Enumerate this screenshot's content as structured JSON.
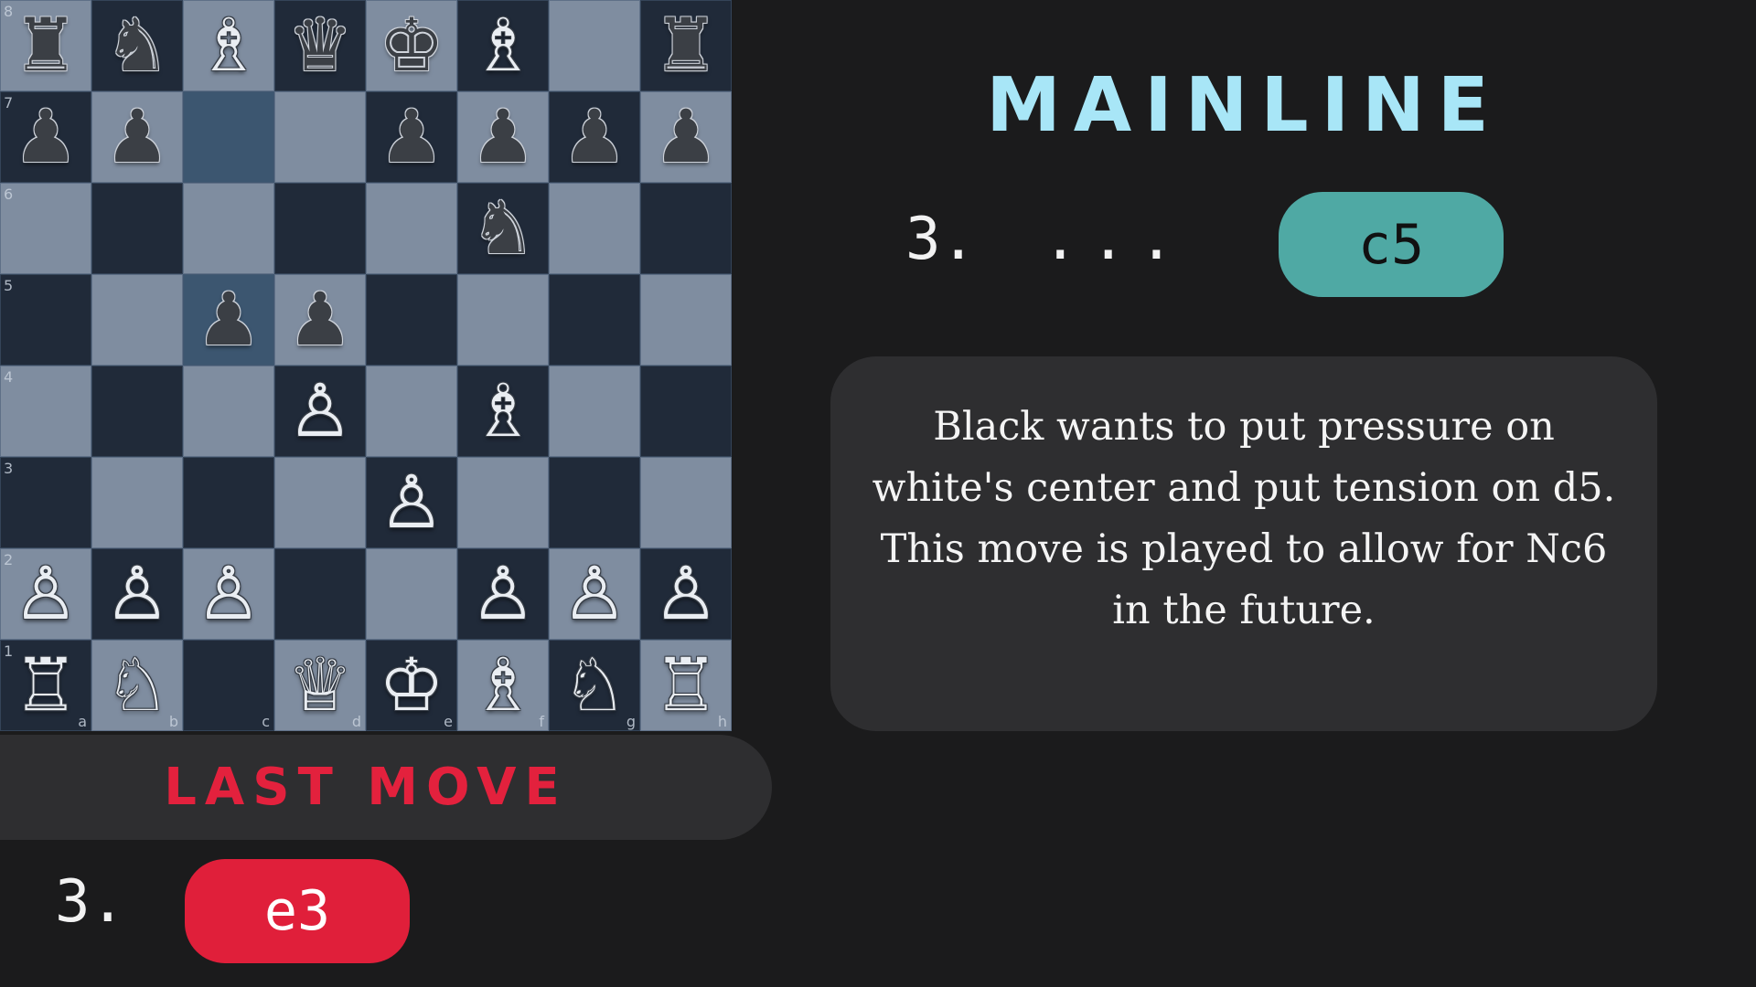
{
  "board": {
    "rank_labels": [
      "8",
      "7",
      "6",
      "5",
      "4",
      "3",
      "2",
      "1"
    ],
    "file_labels": [
      "a",
      "b",
      "c",
      "d",
      "e",
      "f",
      "g",
      "h"
    ],
    "highlighted_squares": [
      "c7",
      "c5"
    ],
    "pieces": {
      "a8": {
        "color": "black",
        "type": "rook",
        "glyph": "♜"
      },
      "b8": {
        "color": "black",
        "type": "knight",
        "glyph": "♞"
      },
      "c8": {
        "color": "white",
        "type": "bishop",
        "glyph": "♗"
      },
      "d8": {
        "color": "black",
        "type": "queen",
        "glyph": "♛"
      },
      "e8": {
        "color": "black",
        "type": "king",
        "glyph": "♚"
      },
      "f8": {
        "color": "white",
        "type": "bishop",
        "glyph": "♗"
      },
      "h8": {
        "color": "black",
        "type": "rook",
        "glyph": "♜"
      },
      "a7": {
        "color": "black",
        "type": "pawn",
        "glyph": "♟"
      },
      "b7": {
        "color": "black",
        "type": "pawn",
        "glyph": "♟"
      },
      "e7": {
        "color": "black",
        "type": "pawn",
        "glyph": "♟"
      },
      "f7": {
        "color": "black",
        "type": "pawn",
        "glyph": "♟"
      },
      "g7": {
        "color": "black",
        "type": "pawn",
        "glyph": "♟"
      },
      "h7": {
        "color": "black",
        "type": "pawn",
        "glyph": "♟"
      },
      "f6": {
        "color": "black",
        "type": "knight",
        "glyph": "♞"
      },
      "c5": {
        "color": "black",
        "type": "pawn",
        "glyph": "♟"
      },
      "d5": {
        "color": "black",
        "type": "pawn",
        "glyph": "♟"
      },
      "d4": {
        "color": "white",
        "type": "pawn",
        "glyph": "♙"
      },
      "f4": {
        "color": "white",
        "type": "bishop",
        "glyph": "♗"
      },
      "e3": {
        "color": "white",
        "type": "pawn",
        "glyph": "♙"
      },
      "a2": {
        "color": "white",
        "type": "pawn",
        "glyph": "♙"
      },
      "b2": {
        "color": "white",
        "type": "pawn",
        "glyph": "♙"
      },
      "c2": {
        "color": "white",
        "type": "pawn",
        "glyph": "♙"
      },
      "f2": {
        "color": "white",
        "type": "pawn",
        "glyph": "♙"
      },
      "g2": {
        "color": "white",
        "type": "pawn",
        "glyph": "♙"
      },
      "h2": {
        "color": "white",
        "type": "pawn",
        "glyph": "♙"
      },
      "a1": {
        "color": "white",
        "type": "rook",
        "glyph": "♖"
      },
      "b1": {
        "color": "white",
        "type": "knight",
        "glyph": "♘"
      },
      "d1": {
        "color": "white",
        "type": "queen",
        "glyph": "♕"
      },
      "e1": {
        "color": "white",
        "type": "king",
        "glyph": "♔"
      },
      "f1": {
        "color": "white",
        "type": "bishop",
        "glyph": "♗"
      },
      "g1": {
        "color": "white",
        "type": "knight",
        "glyph": "♘"
      },
      "h1": {
        "color": "white",
        "type": "rook",
        "glyph": "♖"
      }
    }
  },
  "last_move": {
    "title": "LAST MOVE",
    "move_number": "3.",
    "move": "e3",
    "accent_color": "#e01f3a"
  },
  "mainline": {
    "title": "MAINLINE",
    "move_number": "3.",
    "ellipsis": "...",
    "move": "c5",
    "title_color": "#a8e6f7",
    "pill_color": "#4fa9a4",
    "description": "Black wants to put pressure on white's center and put tension on d5. This move is played to allow for Nc6 in the future."
  }
}
